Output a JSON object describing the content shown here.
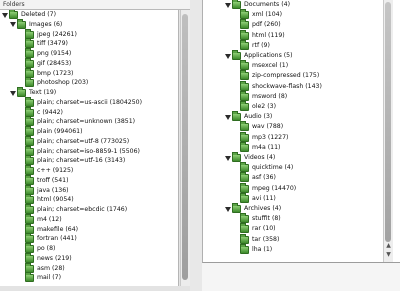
{
  "left": {
    "header": "Folders",
    "items": [
      {
        "label": "Deleted (7)",
        "indent": 0,
        "expanded": true
      },
      {
        "label": "Images (6)",
        "indent": 1,
        "expanded": true
      },
      {
        "label": "jpeg (24261)",
        "indent": 2,
        "expanded": false
      },
      {
        "label": "tiff (3479)",
        "indent": 2,
        "expanded": false
      },
      {
        "label": "png (9154)",
        "indent": 2,
        "expanded": false
      },
      {
        "label": "gif (28453)",
        "indent": 2,
        "expanded": false
      },
      {
        "label": "bmp (1723)",
        "indent": 2,
        "expanded": false
      },
      {
        "label": "photoshop (203)",
        "indent": 2,
        "expanded": false
      },
      {
        "label": "Text (19)",
        "indent": 1,
        "expanded": true
      },
      {
        "label": "plain; charset=us-ascii (1804250)",
        "indent": 2,
        "expanded": false
      },
      {
        "label": "c (9442)",
        "indent": 2,
        "expanded": false
      },
      {
        "label": "plain; charset=unknown (3851)",
        "indent": 2,
        "expanded": false
      },
      {
        "label": "plain (994061)",
        "indent": 2,
        "expanded": false
      },
      {
        "label": "plain; charset=utf-8 (773025)",
        "indent": 2,
        "expanded": false
      },
      {
        "label": "plain; charset=iso-8859-1 (5506)",
        "indent": 2,
        "expanded": false
      },
      {
        "label": "plain; charset=utf-16 (3143)",
        "indent": 2,
        "expanded": false
      },
      {
        "label": "c++ (9125)",
        "indent": 2,
        "expanded": false
      },
      {
        "label": "troff (541)",
        "indent": 2,
        "expanded": false
      },
      {
        "label": "java (136)",
        "indent": 2,
        "expanded": false
      },
      {
        "label": "html (9054)",
        "indent": 2,
        "expanded": false
      },
      {
        "label": "plain; charset=ebcdic (1746)",
        "indent": 2,
        "expanded": false
      },
      {
        "label": "m4 (12)",
        "indent": 2,
        "expanded": false
      },
      {
        "label": "makefile (64)",
        "indent": 2,
        "expanded": false
      },
      {
        "label": "fortran (441)",
        "indent": 2,
        "expanded": false
      },
      {
        "label": "po (8)",
        "indent": 2,
        "expanded": false
      },
      {
        "label": "news (219)",
        "indent": 2,
        "expanded": false
      },
      {
        "label": "asm (28)",
        "indent": 2,
        "expanded": false
      },
      {
        "label": "mail (7)",
        "indent": 2,
        "expanded": false
      }
    ]
  },
  "right": {
    "items": [
      {
        "label": "Documents (4)",
        "indent": 0,
        "expanded": true
      },
      {
        "label": "xml (104)",
        "indent": 1,
        "expanded": false
      },
      {
        "label": "pdf (260)",
        "indent": 1,
        "expanded": false
      },
      {
        "label": "html (119)",
        "indent": 1,
        "expanded": false
      },
      {
        "label": "rtf (9)",
        "indent": 1,
        "expanded": false
      },
      {
        "label": "Applications (5)",
        "indent": 0,
        "expanded": true
      },
      {
        "label": "msexcel (1)",
        "indent": 1,
        "expanded": false
      },
      {
        "label": "zip-compressed (175)",
        "indent": 1,
        "expanded": false
      },
      {
        "label": "shockwave-flash (143)",
        "indent": 1,
        "expanded": false
      },
      {
        "label": "msword (8)",
        "indent": 1,
        "expanded": false
      },
      {
        "label": "ole2 (3)",
        "indent": 1,
        "expanded": false
      },
      {
        "label": "Audio (3)",
        "indent": 0,
        "expanded": true
      },
      {
        "label": "wav (788)",
        "indent": 1,
        "expanded": false
      },
      {
        "label": "mp3 (1227)",
        "indent": 1,
        "expanded": false
      },
      {
        "label": "m4a (11)",
        "indent": 1,
        "expanded": false
      },
      {
        "label": "Videos (4)",
        "indent": 0,
        "expanded": true
      },
      {
        "label": "quicktime (4)",
        "indent": 1,
        "expanded": false
      },
      {
        "label": "asf (36)",
        "indent": 1,
        "expanded": false
      },
      {
        "label": "mpeg (14470)",
        "indent": 1,
        "expanded": false
      },
      {
        "label": "avi (11)",
        "indent": 1,
        "expanded": false
      },
      {
        "label": "Archives (4)",
        "indent": 0,
        "expanded": true
      },
      {
        "label": "stuffit (8)",
        "indent": 1,
        "expanded": false
      },
      {
        "label": "rar (10)",
        "indent": 1,
        "expanded": false
      },
      {
        "label": "tar (358)",
        "indent": 1,
        "expanded": false
      },
      {
        "label": "lha (1)",
        "indent": 1,
        "expanded": false
      }
    ]
  }
}
